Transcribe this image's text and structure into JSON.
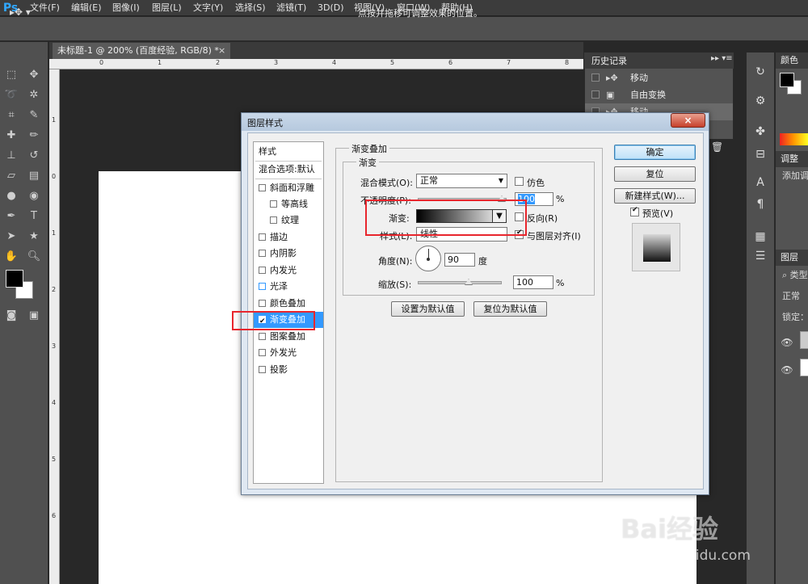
{
  "menubar": {
    "logo": "Ps",
    "items": [
      "文件(F)",
      "编辑(E)",
      "图像(I)",
      "图层(L)",
      "文字(Y)",
      "选择(S)",
      "滤镜(T)",
      "3D(D)",
      "视图(V)",
      "窗口(W)",
      "帮助(H)"
    ]
  },
  "options_bar": {
    "hint": "点按并拖移可调整效果的位置。"
  },
  "document": {
    "tab_title": "未标题-1 @ 200% (百度经验, RGB/8) *",
    "close": "×",
    "ruler_top": [
      "0",
      "1",
      "2",
      "3",
      "4",
      "5",
      "6",
      "7",
      "8"
    ],
    "ruler_left": [
      "1",
      "0",
      "1",
      "2",
      "3",
      "4",
      "5",
      "6"
    ]
  },
  "history": {
    "title": "历史记录",
    "items": [
      {
        "label": "移动",
        "icon": "move-icon"
      },
      {
        "label": "自由变换",
        "icon": "transform-icon"
      },
      {
        "label": "移动",
        "icon": "move-icon"
      }
    ]
  },
  "right_panels": {
    "color_tab": "颜色",
    "adjust_tab": "调整",
    "adjust_text": "添加调",
    "layers_tab": "图层",
    "layer_search": "类型",
    "blend_mode": "正常",
    "lock_label": "锁定："
  },
  "dialog": {
    "title": "图层样式",
    "close": "×",
    "styles_header": "样式",
    "blend_options": "混合选项:默认",
    "styles": [
      {
        "label": "斜面和浮雕",
        "checked": false
      },
      {
        "label": "等高线",
        "checked": false,
        "indent": true
      },
      {
        "label": "纹理",
        "checked": false,
        "indent": true
      },
      {
        "label": "描边",
        "checked": false
      },
      {
        "label": "内阴影",
        "checked": false
      },
      {
        "label": "内发光",
        "checked": false
      },
      {
        "label": "光泽",
        "checked": false
      },
      {
        "label": "颜色叠加",
        "checked": false
      },
      {
        "label": "渐变叠加",
        "checked": true,
        "selected": true
      },
      {
        "label": "图案叠加",
        "checked": false
      },
      {
        "label": "外发光",
        "checked": false
      },
      {
        "label": "投影",
        "checked": false
      }
    ],
    "group_title": "渐变叠加",
    "subgroup_title": "渐变",
    "blend_mode_label": "混合模式(O):",
    "blend_mode_value": "正常",
    "dither_label": "仿色",
    "opacity_label": "不透明度(P):",
    "opacity_value": "100",
    "percent": "%",
    "gradient_label": "渐变:",
    "reverse_label": "反向(R)",
    "style_label": "样式(L):",
    "style_value": "线性",
    "align_label": "与图层对齐(I)",
    "angle_label": "角度(N):",
    "angle_value": "90",
    "angle_unit": "度",
    "scale_label": "缩放(S):",
    "scale_value": "100",
    "dither_checked": false,
    "reverse_checked": false,
    "align_checked": true,
    "make_default": "设置为默认值",
    "reset_default": "复位为默认值",
    "ok": "确定",
    "reset": "复位",
    "new_style": "新建样式(W)...",
    "preview_label": "预览(V)",
    "preview_checked": true
  },
  "watermark": {
    "brand": "Bai经验",
    "url": "jingyan.baidu.com"
  }
}
